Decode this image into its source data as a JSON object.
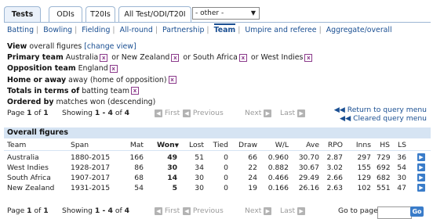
{
  "tabs": [
    "Tests",
    "ODIs",
    "T20Is",
    "All Test/ODI/T20I"
  ],
  "tab_active": 0,
  "format_dropdown": {
    "value": "- other -"
  },
  "nav": [
    "Batting",
    "Bowling",
    "Fielding",
    "All-round",
    "Partnership",
    "Team",
    "Umpire and referee",
    "Aggregate/overall"
  ],
  "nav_current": "Team",
  "criteria": {
    "view_label": "View",
    "view_value": "overall figures",
    "change_view": "[change view]",
    "primary_label": "Primary team",
    "primary_teams": [
      "Australia",
      "or New Zealand",
      "or South Africa",
      "or West Indies"
    ],
    "opposition_label": "Opposition team",
    "opposition_value": "England",
    "home_label": "Home or away",
    "home_value": "away (home of opposition)",
    "totals_label": "Totals in terms of",
    "totals_value": "batting team",
    "ordered_label": "Ordered by",
    "ordered_value": "matches won (descending)"
  },
  "pager_top": {
    "page_label": "Page",
    "page_current": "1",
    "page_of": "of",
    "page_total": "1",
    "showing_label": "Showing",
    "showing_range": "1 - 4",
    "showing_of": "of",
    "showing_total": "4",
    "first": "First",
    "previous": "Previous",
    "next": "Next",
    "last": "Last"
  },
  "return_link": "Return to query menu",
  "cleared_link": "Cleared query menu",
  "table": {
    "title": "Overall figures",
    "columns": [
      "Team",
      "Span",
      "Mat",
      "Won",
      "Lost",
      "Tied",
      "Draw",
      "W/L",
      "Ave",
      "RPO",
      "Inns",
      "HS",
      "LS"
    ],
    "rows": [
      [
        "Australia",
        "1880-2015",
        "166",
        "49",
        "51",
        "0",
        "66",
        "0.960",
        "30.70",
        "2.87",
        "297",
        "729",
        "36"
      ],
      [
        "West Indies",
        "1928-2017",
        "86",
        "30",
        "34",
        "0",
        "22",
        "0.882",
        "30.67",
        "3.02",
        "155",
        "692",
        "54"
      ],
      [
        "South Africa",
        "1907-2017",
        "68",
        "14",
        "30",
        "0",
        "24",
        "0.466",
        "29.49",
        "2.66",
        "129",
        "682",
        "30"
      ],
      [
        "New Zealand",
        "1931-2015",
        "54",
        "5",
        "30",
        "0",
        "19",
        "0.166",
        "26.16",
        "2.63",
        "102",
        "551",
        "47"
      ]
    ]
  },
  "pager_bottom": {
    "page_label": "Page",
    "page_current": "1",
    "page_of": "of",
    "page_total": "1",
    "showing_label": "Showing",
    "showing_range": "1 - 4",
    "showing_of": "of",
    "showing_total": "4",
    "first": "First",
    "previous": "Previous",
    "next": "Next",
    "last": "Last",
    "goto_label": "Go to page",
    "go_button": "Go"
  }
}
